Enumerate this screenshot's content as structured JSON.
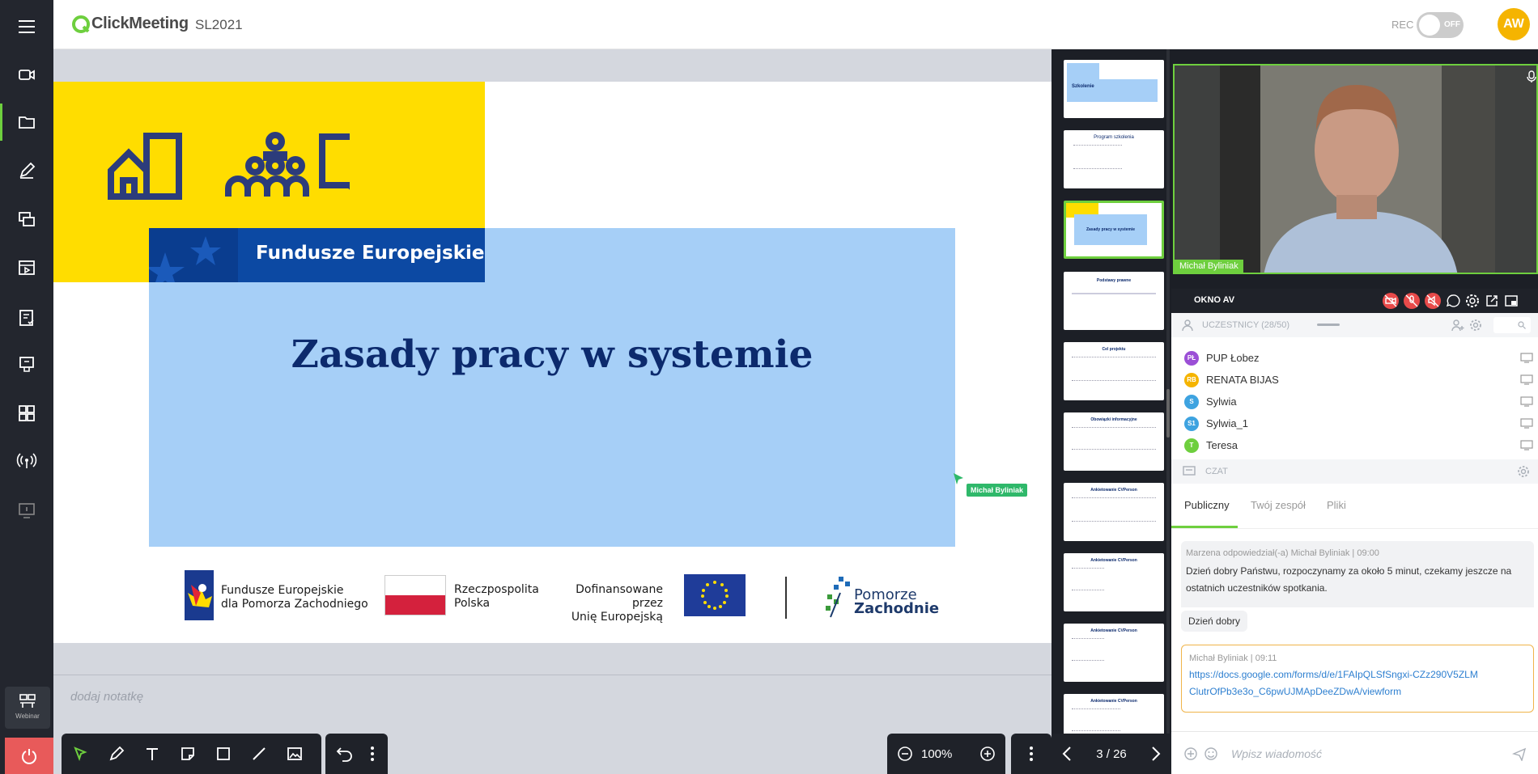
{
  "header": {
    "app_name": "ClickMeeting",
    "room_name": "SL2021",
    "rec_label": "REC",
    "rec_state": "OFF",
    "avatar_initials": "AW"
  },
  "sidebar": {
    "webinar_label": "Webinar",
    "icons": [
      "menu-icon",
      "camera-icon",
      "folder-icon",
      "edit-icon",
      "screen-share-icon",
      "video-icon",
      "test-icon",
      "dashboard-icon",
      "widgets-icon",
      "broadcast-icon",
      "cast-icon",
      "power-icon"
    ]
  },
  "slide": {
    "title": "Zasady pracy w systemie",
    "banner_text": "Fundusze Europejskie",
    "logos": {
      "fe_line1": "Fundusze Europejskie",
      "fe_line2": "dla Pomorza Zachodniego",
      "rp_line1": "Rzeczpospolita",
      "rp_line2": "Polska",
      "ue_line1": "Dofinansowane przez",
      "ue_line2": "Unię Europejską",
      "pz_line1": "Pomorze",
      "pz_line2": "Zachodnie"
    },
    "pointer_label": "Michał Byliniak"
  },
  "notes": {
    "placeholder": "dodaj notatkę"
  },
  "toolbar": {
    "zoom": "100%",
    "page": "3 / 26"
  },
  "thumbnails": {
    "current": 3,
    "total": 26,
    "titles": [
      "Szkolenie",
      "Program szkolenia",
      "Zasady pracy w systemie",
      "Podstawy prawne",
      "Cel projektu",
      "Obowiązki informacyjne",
      "Ankietowanie CVPerson",
      "Ankietowanie CVPerson",
      "Ankietowanie CVPerson",
      "Ankietowanie CVPerson"
    ]
  },
  "video": {
    "speaker": "Michał Byliniak"
  },
  "av": {
    "label": "OKNO AV"
  },
  "participants": {
    "header": "UCZESTNICY (28/50)",
    "list": [
      {
        "initials": "PŁ",
        "name": "PUP Łobez",
        "color": "#9b4fd6"
      },
      {
        "initials": "RB",
        "name": "RENATA BIJAS",
        "color": "#f5b400"
      },
      {
        "initials": "S",
        "name": "Sylwia",
        "color": "#3ea3e0"
      },
      {
        "initials": "S1",
        "name": "Sylwia_1",
        "color": "#3ea3e0"
      },
      {
        "initials": "T",
        "name": "Teresa",
        "color": "#6ecf3e"
      }
    ]
  },
  "chat": {
    "header": "CZAT",
    "tabs": [
      "Publiczny",
      "Twój zespół",
      "Pliki"
    ],
    "messages": [
      {
        "meta": "Marzena odpowiedział(-a) Michał Byliniak | 09:00",
        "text": "Dzień dobry Państwu, rozpoczynamy za około 5 minut, czekamy jeszcze na ostatnich uczestników spotkania.",
        "reply": "Dzień dobry"
      },
      {
        "meta": "Michał Byliniak | 09:11",
        "text": "https://docs.google.com/forms/d/e/1FAIpQLSfSngxi-CZz290V5ZLMClutrOfPb3e3o_C6pwUJMApDeeZDwA/viewform"
      }
    ],
    "input_placeholder": "Wpisz wiadomość"
  },
  "colors": {
    "accent": "#6ecf3e",
    "slide_yellow": "#ffdd00",
    "slide_blue": "#a6cff7",
    "navy": "#0c2a6d",
    "rec_avatar": "#f5b400"
  }
}
